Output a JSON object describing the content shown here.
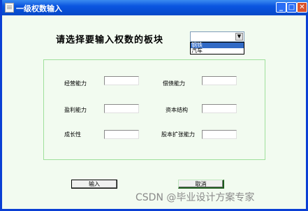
{
  "window": {
    "title": "一级权数输入"
  },
  "heading": "请选择要输入权数的板块",
  "combo": {
    "value": "",
    "options": [
      {
        "label": "钢铁",
        "selected": true
      },
      {
        "label": "汽车",
        "selected": false
      }
    ]
  },
  "fields": [
    {
      "label": "经营能力",
      "value": ""
    },
    {
      "label": "偿债能力",
      "value": ""
    },
    {
      "label": "盈利能力",
      "value": ""
    },
    {
      "label": "资本结构",
      "value": ""
    },
    {
      "label": "成长性",
      "value": ""
    },
    {
      "label": "股本扩张能力",
      "value": ""
    }
  ],
  "buttons": {
    "ok": "输入",
    "cancel": "取消"
  },
  "watermark": "CSDN @毕业设计方案专家"
}
